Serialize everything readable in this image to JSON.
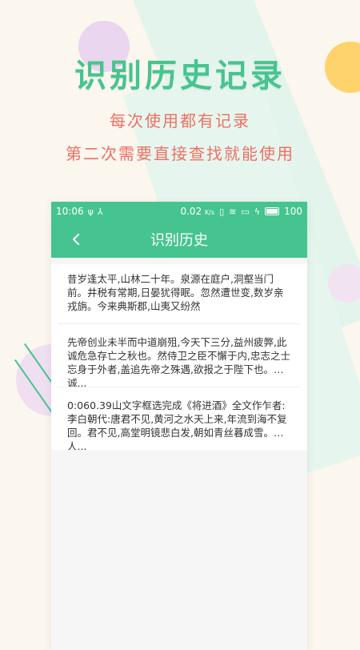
{
  "promo": {
    "title": "识别历史记录",
    "subtitle_1": "每次使用都有记录",
    "subtitle_2": "第二次需要直接查找就能使用"
  },
  "status_bar": {
    "time": "10:06",
    "left_icons": [
      "usb-icon",
      "share-icon"
    ],
    "speed": "0.02",
    "speed_unit": "K/s",
    "right_icons": [
      "vibrate-icon",
      "wifi-icon",
      "screen-icon",
      "charge-icon",
      "battery-icon"
    ],
    "battery": "100"
  },
  "app_bar": {
    "title": "识别历史",
    "back_icon": "chevron-left-icon"
  },
  "history": {
    "items": [
      "昔岁逢太平,山林二十年。泉源在庭户,洞壑当门前。井税有常期,日晏犹得眠。忽然遭世变,数岁亲戎旃。今来典斯郡,山夷又纷然",
      "先帝创业未半而中道崩殂,今天下三分,益州疲弊,此诚危急存亡之秋也。然侍卫之臣不懈于内,忠志之士忘身于外者,盖追先帝之殊遇,欲报之于陛下也。诚...",
      "0:060.39山文字框选完成《将进酒》全文作乍者:李白朝代:唐君不见,黄河之水天上来,年流到海不复回。君不见,高堂明镜悲白发,朝如青丝暮成雪。人..."
    ]
  },
  "colors": {
    "brand_green": "#46c48f",
    "accent_red": "#ef6f62",
    "background": "#fbf6ee"
  }
}
